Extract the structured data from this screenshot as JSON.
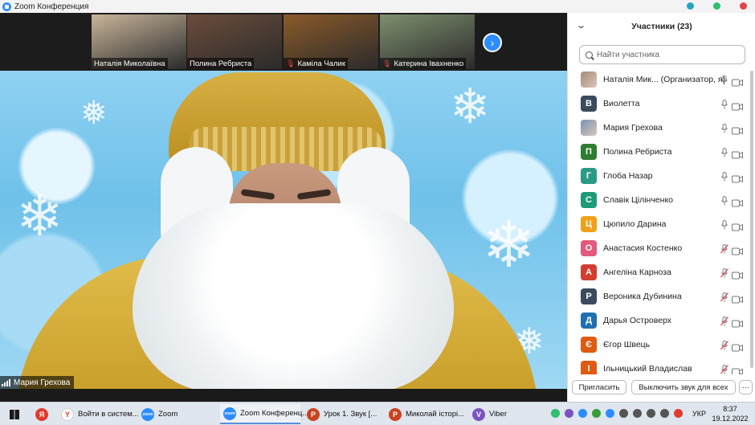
{
  "window": {
    "title": "Zoom Конференция",
    "dots": [
      "#29a3c4",
      "#2fbf71",
      "#e0444c"
    ]
  },
  "thumbnails": [
    {
      "name": "Наталія Миколаївна",
      "muted": false,
      "bg": "#c9b59a"
    },
    {
      "name": "Полина Ребриста",
      "muted": false,
      "bg": "#6b4c3b"
    },
    {
      "name": "Каміла Чалик",
      "muted": true,
      "bg": "#8a5a2a"
    },
    {
      "name": "Катерина Івахненко",
      "muted": true,
      "bg": "#7d8f6e"
    }
  ],
  "speaker": {
    "name": "Мария Грехова"
  },
  "panel": {
    "title": "Участники (23)",
    "search_placeholder": "Найти участника",
    "participants": [
      {
        "initial": "",
        "name": "Наталія Мик... (Организатор, я)",
        "color": "#a78b7b",
        "photo": true,
        "mic_muted": false
      },
      {
        "initial": "В",
        "name": "Виолетта",
        "color": "#3b4a5c",
        "photo": false,
        "mic_muted": false
      },
      {
        "initial": "",
        "name": "Мария Грехова",
        "color": "#7a93b5",
        "photo": true,
        "mic_muted": false
      },
      {
        "initial": "П",
        "name": "Полина Ребриста",
        "color": "#2e7d32",
        "photo": false,
        "mic_muted": false
      },
      {
        "initial": "Г",
        "name": "Глоба Назар",
        "color": "#2a9a86",
        "photo": false,
        "mic_muted": false
      },
      {
        "initial": "С",
        "name": "Славік Цілінченко",
        "color": "#1e9a79",
        "photo": false,
        "mic_muted": false
      },
      {
        "initial": "Ц",
        "name": "Цюпило Дарина",
        "color": "#f0a11a",
        "photo": false,
        "mic_muted": false
      },
      {
        "initial": "О",
        "name": "Анастасия Костенко",
        "color": "#e25a7e",
        "photo": false,
        "mic_muted": true
      },
      {
        "initial": "А",
        "name": "Ангеліна Карноза",
        "color": "#d33d2f",
        "photo": false,
        "mic_muted": true
      },
      {
        "initial": "Р",
        "name": "Вероника Дубинина",
        "color": "#3b4a5c",
        "photo": false,
        "mic_muted": true
      },
      {
        "initial": "Д",
        "name": "Дарья Островерх",
        "color": "#1f6fb2",
        "photo": false,
        "mic_muted": true
      },
      {
        "initial": "Є",
        "name": "Єгор Швець",
        "color": "#e05a10",
        "photo": false,
        "mic_muted": true
      },
      {
        "initial": "І",
        "name": "Ільницький Владислав",
        "color": "#e05a10",
        "photo": false,
        "mic_muted": true
      }
    ],
    "invite_label": "Пригласить",
    "mute_all_label": "Выключить звук для всех",
    "more_label": "···"
  },
  "taskbar": {
    "items": [
      {
        "label": "",
        "icon": "start-icon",
        "color": "#111"
      },
      {
        "label": "",
        "icon": "yandex-icon",
        "color": "#e23b2e",
        "glyph": "Я"
      },
      {
        "label": "Войти в систем...",
        "icon": "yandex-browser-icon",
        "color": "#ffffff",
        "glyph": "Y"
      },
      {
        "label": "Zoom",
        "icon": "zoom-icon",
        "color": "#2d8cff",
        "glyph": "zoom"
      },
      {
        "label": "Zoom Конференц...",
        "icon": "zoom-icon",
        "color": "#2d8cff",
        "glyph": "zoom"
      },
      {
        "label": "Урок 1. Звук [...",
        "icon": "powerpoint-icon",
        "color": "#c9431f",
        "glyph": "P"
      },
      {
        "label": "Миколай історі...",
        "icon": "powerpoint-icon",
        "color": "#c9431f",
        "glyph": "P"
      },
      {
        "label": "Viber",
        "icon": "viber-icon",
        "color": "#7b53c1",
        "glyph": "V"
      }
    ],
    "lang": "УКР",
    "time": "8:37",
    "date": "19.12.2022"
  }
}
